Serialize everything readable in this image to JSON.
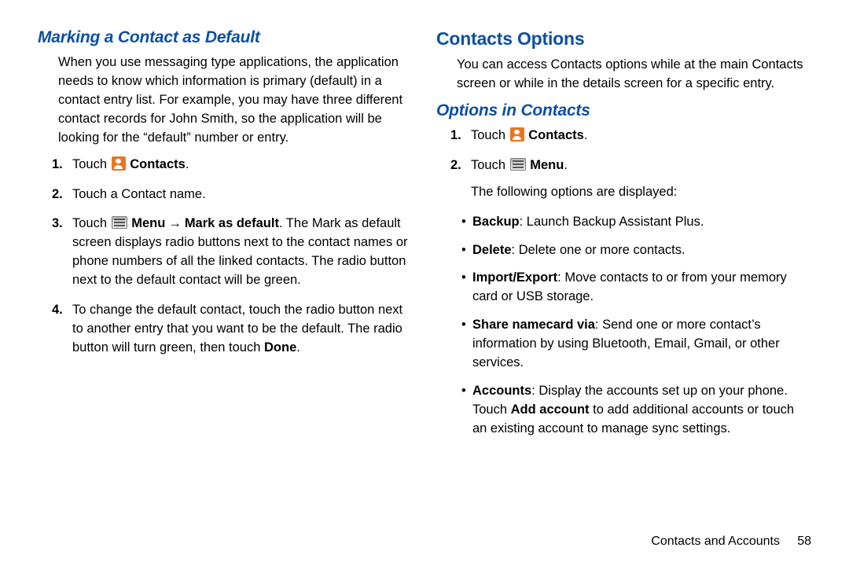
{
  "left": {
    "heading": "Marking a Contact as Default",
    "intro": "When you use messaging type applications, the application needs to know which information is primary (default) in a contact entry list. For example, you may have three different contact records for John Smith, so the application will be looking for the “default” number or entry.",
    "steps": [
      {
        "num": "1.",
        "pre": "Touch ",
        "icon": "contacts",
        "bold": "Contacts",
        "post": "."
      },
      {
        "num": "2.",
        "text": "Touch a Contact name."
      },
      {
        "num": "3.",
        "pre": "Touch ",
        "icon": "menu",
        "bold": "Menu",
        "arrow": "→",
        "bold2": "Mark as default",
        "post": ". The Mark as default screen displays radio buttons next to the contact names or phone numbers of all the linked contacts. The radio button next to the default contact will be green."
      },
      {
        "num": "4.",
        "text_pre": "To change the default contact, touch the radio button next to another entry that you want to be the default. The radio button will turn green, then touch ",
        "bold": "Done",
        "text_post": "."
      }
    ]
  },
  "right": {
    "heading1": "Contacts Options",
    "intro": "You can access Contacts options while at the main Contacts screen or while in the details screen for a specific entry.",
    "heading2": "Options in Contacts",
    "steps": [
      {
        "num": "1.",
        "pre": "Touch ",
        "icon": "contacts",
        "bold": "Contacts",
        "post": "."
      },
      {
        "num": "2.",
        "pre": "Touch ",
        "icon": "menu",
        "bold": "Menu",
        "post": ".",
        "tail": "The following options are displayed:"
      }
    ],
    "bullets": [
      {
        "bold": "Backup",
        "text": ": Launch Backup Assistant Plus."
      },
      {
        "bold": "Delete",
        "text": ": Delete one or more contacts."
      },
      {
        "bold": "Import/Export",
        "text": ": Move contacts to or from your memory card or USB storage."
      },
      {
        "bold": "Share namecard via",
        "text": ": Send one or more contact’s information by using Bluetooth, Email, Gmail, or other services."
      },
      {
        "bold": "Accounts",
        "text_pre": ": Display the accounts set up on your phone. Touch ",
        "bold2": "Add account",
        "text_post": " to add additional accounts or touch an existing account to manage sync settings."
      }
    ]
  },
  "footer": {
    "section": "Contacts and Accounts",
    "page": "58"
  }
}
